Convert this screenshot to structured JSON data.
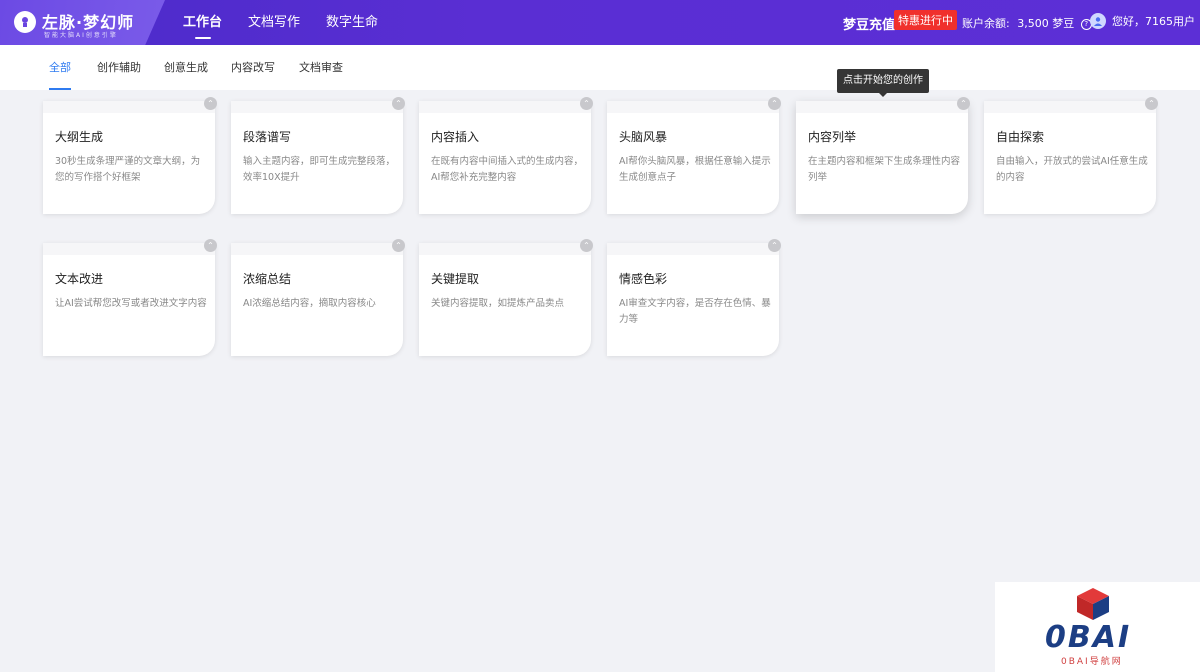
{
  "header": {
    "logo_title": "左脉·梦幻师",
    "logo_sub": "智能大脑AI创意引擎",
    "nav": [
      "工作台",
      "文档写作",
      "数字生命"
    ],
    "recharge": "梦豆充值",
    "promo": "特惠进行中",
    "balance_label": "账户余额:",
    "balance_value": "3,500 梦豆",
    "greeting": "您好，7165用户"
  },
  "tabs": [
    "全部",
    "创作辅助",
    "创意生成",
    "内容改写",
    "文档审查"
  ],
  "tooltip": "点击开始您的创作",
  "cards": [
    {
      "title": "大纲生成",
      "desc": "30秒生成条理严谨的文章大纲，为您的写作搭个好框架"
    },
    {
      "title": "段落谱写",
      "desc": "输入主题内容，即可生成完整段落，效率10X提升"
    },
    {
      "title": "内容插入",
      "desc": "在既有内容中间插入式的生成内容，AI帮您补充完整内容"
    },
    {
      "title": "头脑风暴",
      "desc": "AI帮你头脑风暴，根据任意输入提示生成创意点子"
    },
    {
      "title": "内容列举",
      "desc": "在主题内容和框架下生成条理性内容列举"
    },
    {
      "title": "自由探索",
      "desc": "自由输入，开放式的尝试AI任意生成的内容"
    },
    {
      "title": "文本改进",
      "desc": "让AI尝试帮您改写或者改进文字内容"
    },
    {
      "title": "浓缩总结",
      "desc": "AI浓缩总结内容，摘取内容核心"
    },
    {
      "title": "关键提取",
      "desc": "关键内容提取，如提炼产品卖点"
    },
    {
      "title": "情感色彩",
      "desc": "AI审查文字内容，是否存在色情、暴力等"
    }
  ],
  "watermark": {
    "text": "0BAI",
    "sub": "0BAI导航网"
  },
  "colors": {
    "accent": "#2f7bf0",
    "header": "#5a2ed3",
    "promo": "#f0302c"
  }
}
